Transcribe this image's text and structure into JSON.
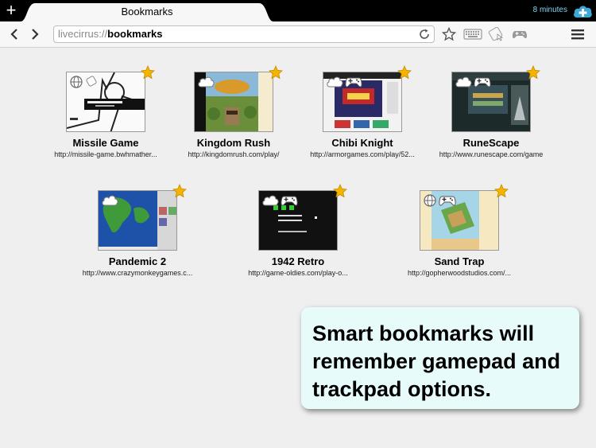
{
  "tab": {
    "title": "Bookmarks"
  },
  "timer": {
    "label": "8 minutes"
  },
  "url": {
    "scheme": "livecirrus://",
    "path": "bookmarks"
  },
  "icons": {
    "new_tab": "plus-icon",
    "cloud": "cloud-add-icon",
    "back": "chevron-left-icon",
    "forward": "chevron-right-icon",
    "reload": "reload-icon",
    "star": "star-icon",
    "keyboard": "keyboard-icon",
    "trackpad": "trackpad-icon",
    "gamepad": "gamepad-icon",
    "menu": "menu-icon"
  },
  "colors": {
    "accent": "#3da9d6",
    "star": "#f5b400",
    "callout_bg": "#e8fbfb"
  },
  "bookmarks": [
    {
      "title": "Missile Game",
      "url": "http://missile-game.bwhmather...",
      "badges": [
        "globe",
        "trackpad"
      ]
    },
    {
      "title": "Kingdom Rush",
      "url": "http://kingdomrush.com/play/",
      "badges": [
        "cloud"
      ]
    },
    {
      "title": "Chibi Knight",
      "url": "http://armorgames.com/play/52...",
      "badges": [
        "cloud",
        "gamepad"
      ]
    },
    {
      "title": "RuneScape",
      "url": "http://www.runescape.com/game",
      "badges": [
        "cloud",
        "gamepad"
      ]
    },
    {
      "title": "Pandemic 2",
      "url": "http://www.crazymonkeygames.c...",
      "badges": [
        "cloud"
      ]
    },
    {
      "title": "1942 Retro",
      "url": "http://game-oldies.com/play-o...",
      "badges": [
        "cloud",
        "gamepad"
      ]
    },
    {
      "title": "Sand Trap",
      "url": "http://gopherwoodstudios.com/...",
      "badges": [
        "globe",
        "gamepad"
      ]
    }
  ],
  "callout": {
    "text": "Smart bookmarks will remember gamepad and trackpad options."
  }
}
